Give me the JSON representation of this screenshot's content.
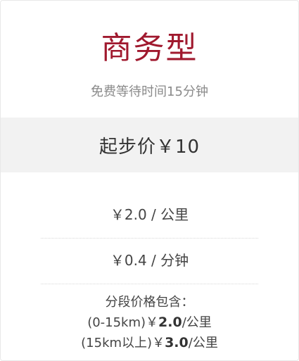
{
  "card": {
    "title": "商务型",
    "subtitle": "免费等待时间15分钟",
    "start_price": "起步价￥10",
    "rate_per_km": "￥2.0 / 公里",
    "rate_per_min": "￥0.4 / 分钟",
    "tier_heading": "分段价格包含：",
    "tiers": [
      {
        "range": "(0-15km)",
        "currency": "￥",
        "price": "2.0",
        "unit": "/公里"
      },
      {
        "range": "(15km以上)",
        "currency": "￥",
        "price": "3.0",
        "unit": "/公里"
      }
    ]
  },
  "colors": {
    "title": "#a0192e",
    "band": "#f2f2f2"
  }
}
